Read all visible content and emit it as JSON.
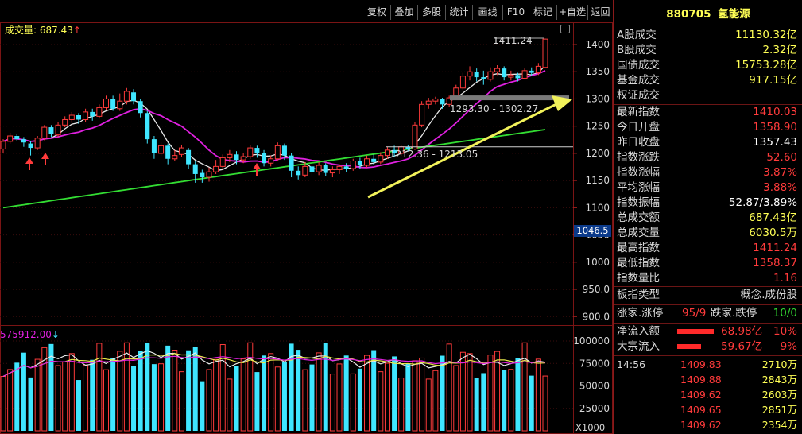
{
  "toolbar": {
    "items": [
      "复权",
      "叠加",
      "多股",
      "统计",
      "画线",
      "F10",
      "标记",
      "+自选",
      "返回"
    ]
  },
  "main_chart": {
    "indicator_label": "成交量: 687.43",
    "high_label": "1411.24",
    "level_label_upper": "1293.30 - 1302.27",
    "level_label_lower": "1212.36 - 1213.05",
    "cursor_value": "1046.5",
    "y_ticks": [
      "1400",
      "1350",
      "1300",
      "1250",
      "1200",
      "1150",
      "1100",
      "1050",
      "1000",
      "950.0",
      "900.0"
    ]
  },
  "volume_chart": {
    "label": "575912.00",
    "y_ticks": [
      "100000",
      "75000",
      "50000",
      "25000"
    ],
    "unit": "X1000"
  },
  "colors": {
    "up": "#ff3b3b",
    "down": "#3fe6ff",
    "ma_white": "#e8e8e8",
    "ma_magenta": "#e020e0",
    "ma_green": "#33dd33",
    "ma_yellow": "#e8e84a",
    "arrow": "#f2f25a",
    "value_yellow": "#ffff55",
    "value_white": "#ffffff",
    "value_red": "#ff3b3b",
    "value_green": "#33dd33"
  },
  "quote_panel": {
    "code": "880705",
    "name": "氢能源",
    "rows": [
      {
        "label": "A股成交",
        "value": "11130.32亿",
        "color": "yellow"
      },
      {
        "label": "B股成交",
        "value": "2.32亿",
        "color": "yellow"
      },
      {
        "label": "国债成交",
        "value": "15753.28亿",
        "color": "yellow"
      },
      {
        "label": "基金成交",
        "value": "917.15亿",
        "color": "yellow"
      },
      {
        "label": "权证成交",
        "value": "",
        "color": "yellow"
      },
      {
        "label": "最新指数",
        "value": "1410.03",
        "color": "red"
      },
      {
        "label": "今日开盘",
        "value": "1358.90",
        "color": "red"
      },
      {
        "label": "昨日收盘",
        "value": "1357.43",
        "color": "white"
      },
      {
        "label": "指数涨跌",
        "value": "52.60",
        "color": "red"
      },
      {
        "label": "指数涨幅",
        "value": "3.87%",
        "color": "red"
      },
      {
        "label": "平均涨幅",
        "value": "3.88%",
        "color": "red"
      },
      {
        "label": "指数振幅",
        "value": "52.87/3.89%",
        "color": "white"
      },
      {
        "label": "总成交额",
        "value": "687.43亿",
        "color": "yellow"
      },
      {
        "label": "总成交量",
        "value": "6030.5万",
        "color": "yellow"
      },
      {
        "label": "最高指数",
        "value": "1411.24",
        "color": "red"
      },
      {
        "label": "最低指数",
        "value": "1358.37",
        "color": "red"
      },
      {
        "label": "指数量比",
        "value": "1.16",
        "color": "red"
      }
    ],
    "board_type": {
      "label": "板指类型",
      "value": "概念.成份股"
    },
    "breadth": {
      "up_label": "涨家.涨停",
      "up_value": "95/9",
      "down_label": "跌家.跌停",
      "down_value": "10/0"
    },
    "flows": [
      {
        "label": "净流入额",
        "value": "68.98亿",
        "pct": "10%",
        "fill": 0.95
      },
      {
        "label": "大宗流入",
        "value": "59.67亿",
        "pct": "9%",
        "fill": 0.62
      }
    ],
    "ticks": [
      {
        "time": "14:56",
        "price": "1409.83",
        "vol": "2710万"
      },
      {
        "time": "",
        "price": "1409.88",
        "vol": "2843万"
      },
      {
        "time": "",
        "price": "1409.62",
        "vol": "2603万"
      },
      {
        "time": "",
        "price": "1409.65",
        "vol": "2851万"
      },
      {
        "time": "",
        "price": "1409.62",
        "vol": "2354万"
      }
    ]
  }
}
